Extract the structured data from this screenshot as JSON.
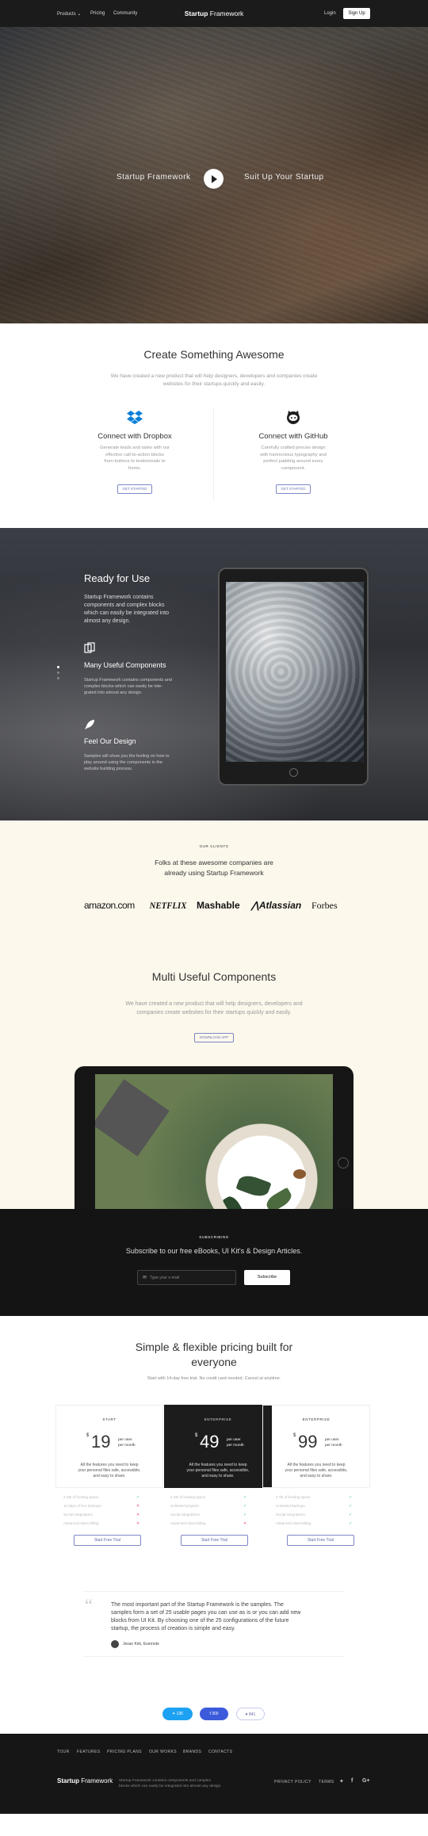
{
  "nav": {
    "products": "Products",
    "pricing": "Pricing",
    "community": "Community",
    "brand_bold": "Startup",
    "brand_light": " Framework",
    "login": "Login",
    "signup": "Sign Up"
  },
  "hero": {
    "left_text": "Startup  Framework",
    "right_text": "Suit Up Your  Startup"
  },
  "create": {
    "title": "Create Something Awesome",
    "subtitle_1": "We have created a new product that will help designers, developers and companies create",
    "subtitle_2": "websites for their startups quickly and easily.",
    "cards": [
      {
        "title": "Connect with Dropbox",
        "lines": [
          "Generate leads and sales with our",
          "effective call-to-action blocks",
          "from buttons to testimonials to",
          "forms."
        ],
        "button": "GET STARTED",
        "icon": "dropbox-icon"
      },
      {
        "title": "Connect with GitHub",
        "lines": [
          "Carefully crafted precise design",
          "with harmonious typography and",
          "perfect padding around every",
          "component."
        ],
        "button": "GET STARTED",
        "icon": "github-icon"
      }
    ]
  },
  "ready": {
    "title": "Ready for Use",
    "text": [
      "Startup Framework contains",
      "components and complex blocks",
      "which can easily be integrated into",
      "almost any design."
    ],
    "feature1_title": "Many Useful Components",
    "feature1_text": [
      "Startup Framework contains components and",
      "complex blocks which can easily be inte-",
      "grated into almost any design."
    ],
    "feature2_title": "Feel Our Design",
    "feature2_text": [
      "Samples will show you the feeling on how to",
      "play around using the components in the",
      "website building process."
    ]
  },
  "clients": {
    "label": "OUR CLIENTS",
    "title_1": "Folks at these awesome companies are",
    "title_2": "already using Startup Framework",
    "logos": [
      "amazon.com",
      "NETFLIX",
      "Mashable",
      "Atlassian",
      "Forbes"
    ]
  },
  "multi": {
    "title": "Multi Useful Components",
    "subtitle_1": "We have created a new product that will help designers, developers and",
    "subtitle_2": "companies create websites for their startups quickly and easily.",
    "button": "DOWNLOAD APP"
  },
  "subscribe": {
    "label": "SUBSCRIBING",
    "title": "Subscribe to our free eBooks, UI Kit's & Design Articles.",
    "placeholder": "Type your e-mail",
    "button": "Subscribe"
  },
  "pricing": {
    "title_1": "Simple & flexible pricing built for",
    "title_2": "everyone",
    "subtitle": "Start with 14-day free trial. No credit card needed. Cancel at anytime.",
    "plans": [
      {
        "name": "START",
        "currency": "$",
        "price": "19",
        "per_1": "per user",
        "per_2": "per month",
        "desc": [
          "All the features you need to keep",
          "your personal files safe, accessible,",
          "and easy to share."
        ],
        "features": [
          "2 GB of hosting space",
          "14 days of free backups",
          "Social integrations",
          "Advanced client billing"
        ],
        "marks": [
          "✓",
          "✕",
          "✕",
          "✕"
        ],
        "button": "Start Free Trial"
      },
      {
        "name": "ENTERPRISE",
        "currency": "$",
        "price": "49",
        "per_1": "per user",
        "per_2": "per month",
        "desc": [
          "All the features you need to keep",
          "your personal files safe, accessible,",
          "and easy to share."
        ],
        "features": [
          "2 GB of hosting space",
          "Unlimited projects",
          "Social integrations",
          "Advanced client billing"
        ],
        "marks": [
          "✓",
          "✓",
          "✓",
          "✕"
        ],
        "button": "Start Free Trial"
      },
      {
        "name": "ENTERPRISE",
        "currency": "$",
        "price": "99",
        "per_1": "per user",
        "per_2": "per month",
        "desc": [
          "All the features you need to keep",
          "your personal files safe, accessible,",
          "and easy to share."
        ],
        "features": [
          "2 TB of hosting space",
          "Unlimited backups",
          "Social integrations",
          "Advanced client billing"
        ],
        "marks": [
          "✓",
          "✓",
          "✓",
          "✓"
        ],
        "button": "Start Free Trial"
      }
    ]
  },
  "quote": {
    "text": [
      "The most important part of the Startup Framework is the samples. The",
      "samples form a set of 25 usable pages you can use as is or you can add new",
      "blocks from UI Kit. By choosing one of the 25 configurations of the future",
      "startup, the process of creation is simple and easy."
    ],
    "author": "Jesse Kirk, Evernote",
    "shares": [
      "136",
      "300",
      "841"
    ]
  },
  "footer": {
    "links": [
      "TOUR",
      "FEATURES",
      "PRICING PLANS",
      "OUR WORKS",
      "BRANDS",
      "CONTACTS"
    ],
    "brand_bold": "Startup",
    "brand_light": " Framework",
    "desc_1": "Startup Framework contains components and complex",
    "desc_2": "blocks which can easily be integrated into almost any design.",
    "policy": "PRIVACY POLICY",
    "terms": "TERMS"
  },
  "colors": {
    "accent": "#5f69aa",
    "cream": "#fcf8ec",
    "dark": "#161616",
    "twitter": "#1da1f2",
    "facebook": "#3b5bdb"
  }
}
